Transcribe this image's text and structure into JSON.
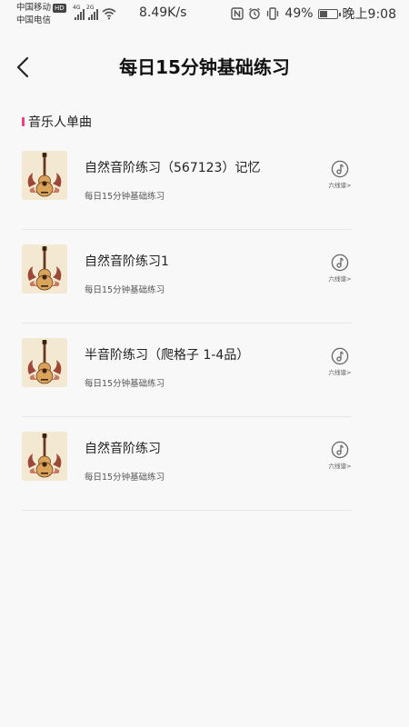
{
  "status_bar": {
    "carrier1": "中国移动",
    "hd_badge": "HD",
    "carrier2": "中国电信",
    "net1": "4G",
    "net2": "2G",
    "speed": "8.49K/s",
    "battery_percent": "49%",
    "battery_level": 0.49,
    "time": "晚上9:08"
  },
  "header": {
    "title": "每日15分钟基础练习"
  },
  "section": {
    "title": "音乐人单曲"
  },
  "songs": [
    {
      "title": "自然音阶练习（567123）记忆",
      "subtitle": "每日15分钟基础练习",
      "action_label": "六线谱>"
    },
    {
      "title": "自然音阶练习1",
      "subtitle": "每日15分钟基础练习",
      "action_label": "六线谱>"
    },
    {
      "title": "半音阶练习（爬格子 1-4品）",
      "subtitle": "每日15分钟基础练习",
      "action_label": "六线谱>"
    },
    {
      "title": "自然音阶练习",
      "subtitle": "每日15分钟基础练习",
      "action_label": "六线谱>"
    }
  ],
  "colors": {
    "accent": "#e8418a",
    "background": "#f8f8f8"
  }
}
